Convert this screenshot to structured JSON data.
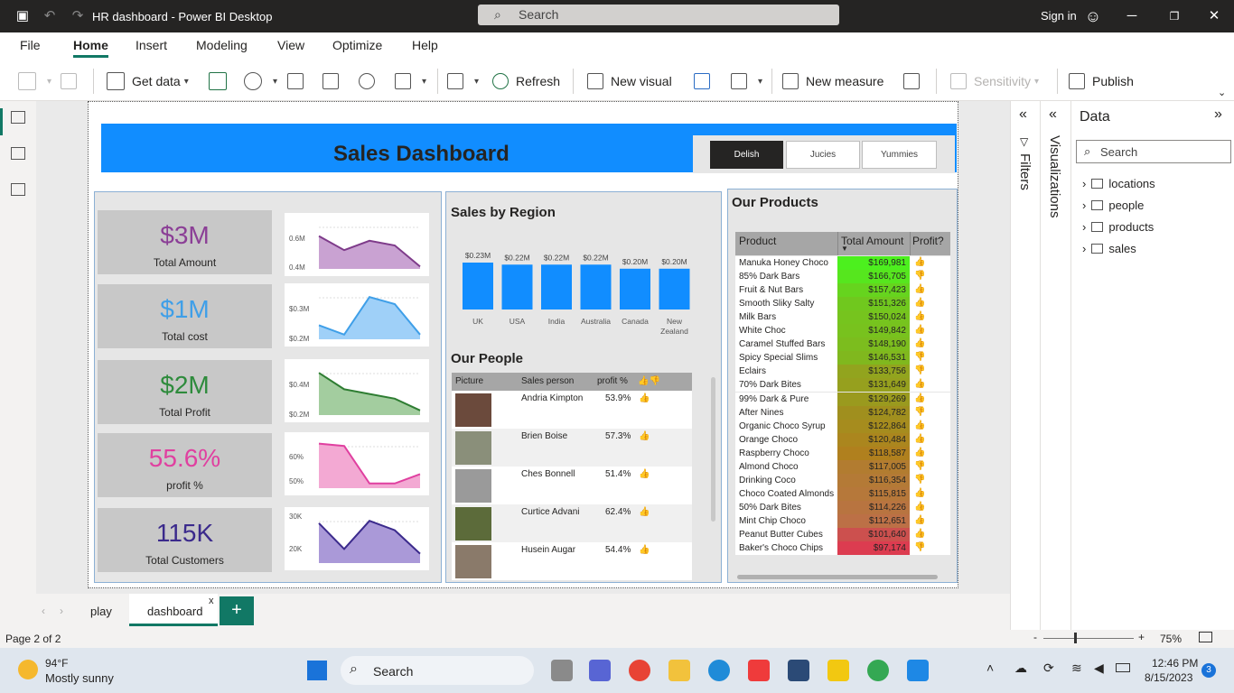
{
  "window": {
    "title": "HR dashboard - Power BI Desktop",
    "search_placeholder": "Search",
    "sign_in": "Sign in"
  },
  "menu": [
    "File",
    "Home",
    "Insert",
    "Modeling",
    "View",
    "Optimize",
    "Help"
  ],
  "ribbon": {
    "get_data": "Get data",
    "refresh": "Refresh",
    "new_visual": "New visual",
    "new_measure": "New measure",
    "sensitivity": "Sensitivity",
    "publish": "Publish"
  },
  "dashboard": {
    "title": "Sales Dashboard",
    "slicer": [
      "Delish",
      "Jucies",
      "Yummies"
    ],
    "slicer_selected": "Delish",
    "kpis": [
      {
        "value": "$3M",
        "label": "Total Amount",
        "color": "#8b3f96",
        "spark_top": "0.6M",
        "spark_bottom": "0.4M",
        "spark_fill": "#c9a2d2",
        "spark_line": "#7e3b8a",
        "trend": [
          0.7,
          0.4,
          0.6,
          0.5,
          0.05
        ]
      },
      {
        "value": "$1M",
        "label": "Total cost",
        "color": "#3f9fe8",
        "spark_top": "$0.3M",
        "spark_bottom": "$0.2M",
        "spark_fill": "#9fd0f8",
        "spark_line": "#3f9fe8",
        "trend": [
          0.3,
          0.1,
          0.9,
          0.75,
          0.1
        ]
      },
      {
        "value": "$2M",
        "label": "Total Profit",
        "color": "#2e8b3c",
        "spark_top": "$0.4M",
        "spark_bottom": "$0.2M",
        "spark_fill": "#a3cd9f",
        "spark_line": "#2e7d32",
        "trend": [
          0.9,
          0.55,
          0.45,
          0.35,
          0.1
        ]
      },
      {
        "value": "55.6%",
        "label": "profit %",
        "color": "#e040a0",
        "spark_top": "60%",
        "spark_bottom": "50%",
        "spark_fill": "#f3a9d3",
        "spark_line": "#e040a0",
        "trend": [
          0.95,
          0.9,
          0.1,
          0.1,
          0.3
        ]
      },
      {
        "value": "115K",
        "label": "Total Customers",
        "color": "#3b2a8c",
        "spark_top": "30K",
        "spark_bottom": "20K",
        "spark_fill": "#aa99d8",
        "spark_line": "#3b2a8c",
        "trend": [
          0.85,
          0.3,
          0.9,
          0.7,
          0.2
        ]
      }
    ],
    "region": {
      "title": "Sales by Region",
      "chart_data": {
        "type": "bar",
        "categories": [
          "UK",
          "USA",
          "India",
          "Australia",
          "Canada",
          "New Zealand"
        ],
        "values": [
          0.23,
          0.22,
          0.22,
          0.22,
          0.2,
          0.2
        ],
        "labels": [
          "$0.23M",
          "$0.22M",
          "$0.22M",
          "$0.22M",
          "$0.20M",
          "$0.20M"
        ],
        "color": "#118dff"
      }
    },
    "people": {
      "title": "Our People",
      "headers": [
        "Picture",
        "Sales person",
        "profit %",
        "👍👎"
      ],
      "rows": [
        {
          "name": "Andria Kimpton",
          "profit": "53.9%"
        },
        {
          "name": "Brien Boise",
          "profit": "57.3%"
        },
        {
          "name": "Ches Bonnell",
          "profit": "51.4%"
        },
        {
          "name": "Curtice Advani",
          "profit": "62.4%"
        },
        {
          "name": "Husein Augar",
          "profit": "54.4%"
        }
      ]
    },
    "products": {
      "title": "Our Products",
      "headers": [
        "Product",
        "Total Amount",
        "Profit?"
      ],
      "rows": [
        {
          "name": "Manuka Honey Choco",
          "amount": "$169,981",
          "color": "#4cf01e",
          "up": true
        },
        {
          "name": "85% Dark Bars",
          "amount": "$166,705",
          "color": "#56e61e",
          "up": false
        },
        {
          "name": "Fruit & Nut Bars",
          "amount": "$157,423",
          "color": "#66d41e",
          "up": true
        },
        {
          "name": "Smooth Sliky Salty",
          "amount": "$151,326",
          "color": "#70c81e",
          "up": true
        },
        {
          "name": "Milk Bars",
          "amount": "$150,024",
          "color": "#76c41e",
          "up": true
        },
        {
          "name": "White Choc",
          "amount": "$149,842",
          "color": "#78c21e",
          "up": true
        },
        {
          "name": "Caramel Stuffed Bars",
          "amount": "$148,190",
          "color": "#7cbd1e",
          "up": true
        },
        {
          "name": "Spicy Special Slims",
          "amount": "$146,531",
          "color": "#80b81e",
          "up": false
        },
        {
          "name": "Eclairs",
          "amount": "$133,756",
          "color": "#92a41e",
          "up": false
        },
        {
          "name": "70% Dark Bites",
          "amount": "$131,649",
          "color": "#96a01e",
          "up": true
        },
        {
          "name": "99% Dark & Pure",
          "amount": "$129,269",
          "color": "#9a9a1e",
          "up": true
        },
        {
          "name": "After Nines",
          "amount": "$124,782",
          "color": "#a08f1e",
          "up": false
        },
        {
          "name": "Organic Choco Syrup",
          "amount": "$122,864",
          "color": "#a68c1e",
          "up": true
        },
        {
          "name": "Orange Choco",
          "amount": "$120,484",
          "color": "#ab861e",
          "up": true
        },
        {
          "name": "Raspberry Choco",
          "amount": "$118,587",
          "color": "#b0801e",
          "up": true
        },
        {
          "name": "Almond Choco",
          "amount": "$117,005",
          "color": "#b27c30",
          "up": false
        },
        {
          "name": "Drinking Coco",
          "amount": "$116,354",
          "color": "#b47a36",
          "up": false
        },
        {
          "name": "Choco Coated Almonds",
          "amount": "$115,815",
          "color": "#b6783a",
          "up": true
        },
        {
          "name": "50% Dark Bites",
          "amount": "$114,226",
          "color": "#b87440",
          "up": true
        },
        {
          "name": "Mint Chip Choco",
          "amount": "$112,651",
          "color": "#bc7046",
          "up": true
        },
        {
          "name": "Peanut Butter Cubes",
          "amount": "$101,640",
          "color": "#cc504e",
          "up": true
        },
        {
          "name": "Baker's Choco Chips",
          "amount": "$97,174",
          "color": "#dc3c50",
          "up": false
        }
      ]
    }
  },
  "panes": {
    "filters": "Filters",
    "visualizations": "Visualizations",
    "data": "Data",
    "data_search": "Search",
    "tables": [
      "locations",
      "people",
      "products",
      "sales"
    ]
  },
  "tabs": {
    "play": "play",
    "dashboard": "dashboard",
    "close": "x",
    "add": "+"
  },
  "status": {
    "page": "Page 2 of 2",
    "zoom": "75%"
  },
  "taskbar": {
    "temp": "94°F",
    "weather": "Mostly sunny",
    "search": "Search",
    "time": "12:46 PM",
    "date": "8/15/2023",
    "notif": "3"
  }
}
